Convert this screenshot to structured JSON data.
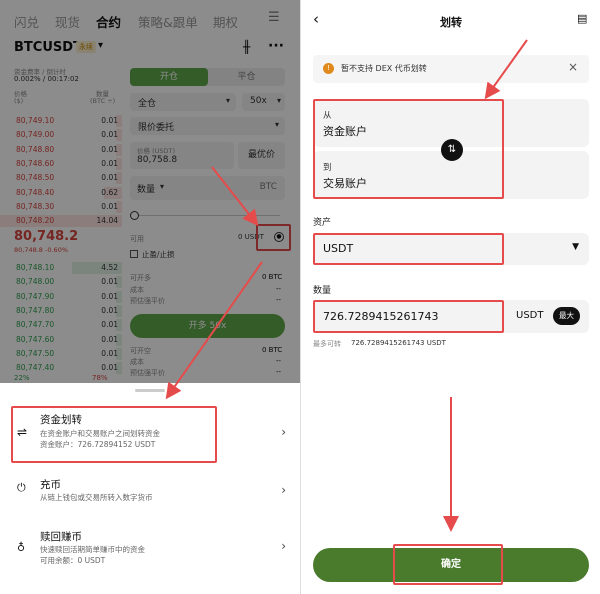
{
  "left": {
    "top_tabs": [
      "闪兑",
      "现货",
      "合约",
      "策略&跟单",
      "期权"
    ],
    "pair": "BTCUSDT",
    "pair_badge": "永续",
    "funding_label": "资金费率 / 倒计时",
    "funding_value": "0.002% / 00:17:02",
    "col_price_label": "价格",
    "col_price_unit": "($)",
    "col_qty_label": "数量",
    "col_qty_unit": "(BTC ÷)",
    "asks": [
      {
        "price": "80,749.10",
        "qty": "0.01"
      },
      {
        "price": "80,749.00",
        "qty": "0.01"
      },
      {
        "price": "80,748.80",
        "qty": "0.01"
      },
      {
        "price": "80,748.60",
        "qty": "0.01"
      },
      {
        "price": "80,748.50",
        "qty": "0.01"
      },
      {
        "price": "80,748.40",
        "qty": "0.62"
      },
      {
        "price": "80,748.30",
        "qty": "0.01"
      },
      {
        "price": "80,748.20",
        "qty": "14.04"
      }
    ],
    "last_price": "80,748.2",
    "last_price_sub": "80,748.8 -0.60%",
    "bids": [
      {
        "price": "80,748.10",
        "qty": "4.52"
      },
      {
        "price": "80,748.00",
        "qty": "0.01"
      },
      {
        "price": "80,747.90",
        "qty": "0.01"
      },
      {
        "price": "80,747.80",
        "qty": "0.01"
      },
      {
        "price": "80,747.70",
        "qty": "0.01"
      },
      {
        "price": "80,747.60",
        "qty": "0.01"
      },
      {
        "price": "80,747.50",
        "qty": "0.01"
      },
      {
        "price": "80,747.40",
        "qty": "0.01"
      }
    ],
    "ratio_left": "22%",
    "ratio_right": "78%",
    "open_tab": "开仓",
    "close_tab": "平仓",
    "margin_mode": "全仓",
    "leverage": "50x",
    "order_type": "限价委托",
    "price_label": "价格 (USDT)",
    "price_value": "80,758.8",
    "best_price": "最优价",
    "qty_label": "数量",
    "qty_unit": "BTC",
    "available_label": "可用",
    "available_value": "0 USDT",
    "tpsl_label": "止盈/止损",
    "can_open_label": "可开多",
    "can_open_value": "0 BTC",
    "cost_label": "成本",
    "cost_value": "--",
    "liq_label": "预估强平价",
    "liq_value": "--",
    "open_long_btn": "开多 50x",
    "can_short_label": "可开空",
    "can_short_value": "0 BTC",
    "cost2_label": "成本",
    "cost2_value": "--",
    "liq2_label": "预估强平价",
    "liq2_value": "--",
    "options": [
      {
        "title": "资金划转",
        "sub1": "在资金账户和交易账户之间划转资金",
        "sub2": "资金账户：726.72894152 USDT"
      },
      {
        "title": "充币",
        "sub1": "从链上钱包或交易所转入数字货币",
        "sub2": ""
      },
      {
        "title": "赎回赚币",
        "sub1": "快速赎回活期简单赚币中的资金",
        "sub2": "可用余额：0 USDT"
      }
    ]
  },
  "right": {
    "title": "划转",
    "notice": "暂不支持 DEX 代币划转",
    "from_label": "从",
    "from_value": "资金账户",
    "to_label": "到",
    "to_value": "交易账户",
    "asset_label": "资产",
    "asset_value": "USDT",
    "amount_label": "数量",
    "amount_value": "726.7289415261743",
    "amount_unit": "USDT",
    "max_btn": "最大",
    "max_transfer_label": "最多可转",
    "max_transfer_value": "726.7289415261743 USDT",
    "confirm": "确定"
  },
  "colors": {
    "accent_green": "#4a7a2c",
    "ask_red": "#d6453f",
    "bid_green": "#2e9f4d",
    "highlight_red": "#e64b4b"
  }
}
